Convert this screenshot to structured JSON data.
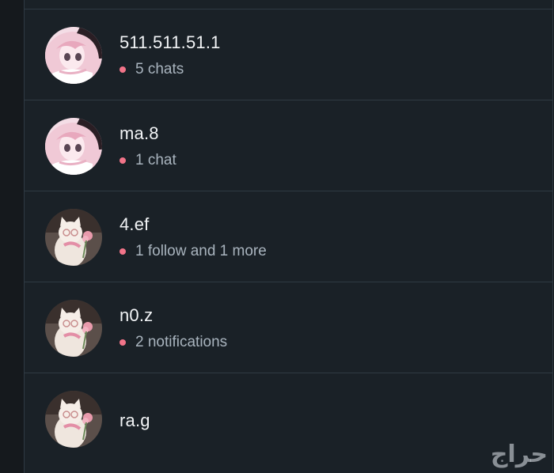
{
  "accent_color": "#f27489",
  "accounts": [
    {
      "username": "511.511.51.1",
      "status": "5 chats",
      "avatar": "anime-girl-avatar"
    },
    {
      "username": "ma.8",
      "status": "1 chat",
      "avatar": "anime-girl-avatar"
    },
    {
      "username": "4.ef",
      "status": "1 follow and 1 more",
      "avatar": "cat-with-rose-avatar"
    },
    {
      "username": "n0.z",
      "status": "2 notifications",
      "avatar": "cat-with-rose-avatar"
    },
    {
      "username": "ra.g",
      "status": "",
      "avatar": "cat-with-rose-avatar"
    }
  ],
  "watermark": "حراج"
}
